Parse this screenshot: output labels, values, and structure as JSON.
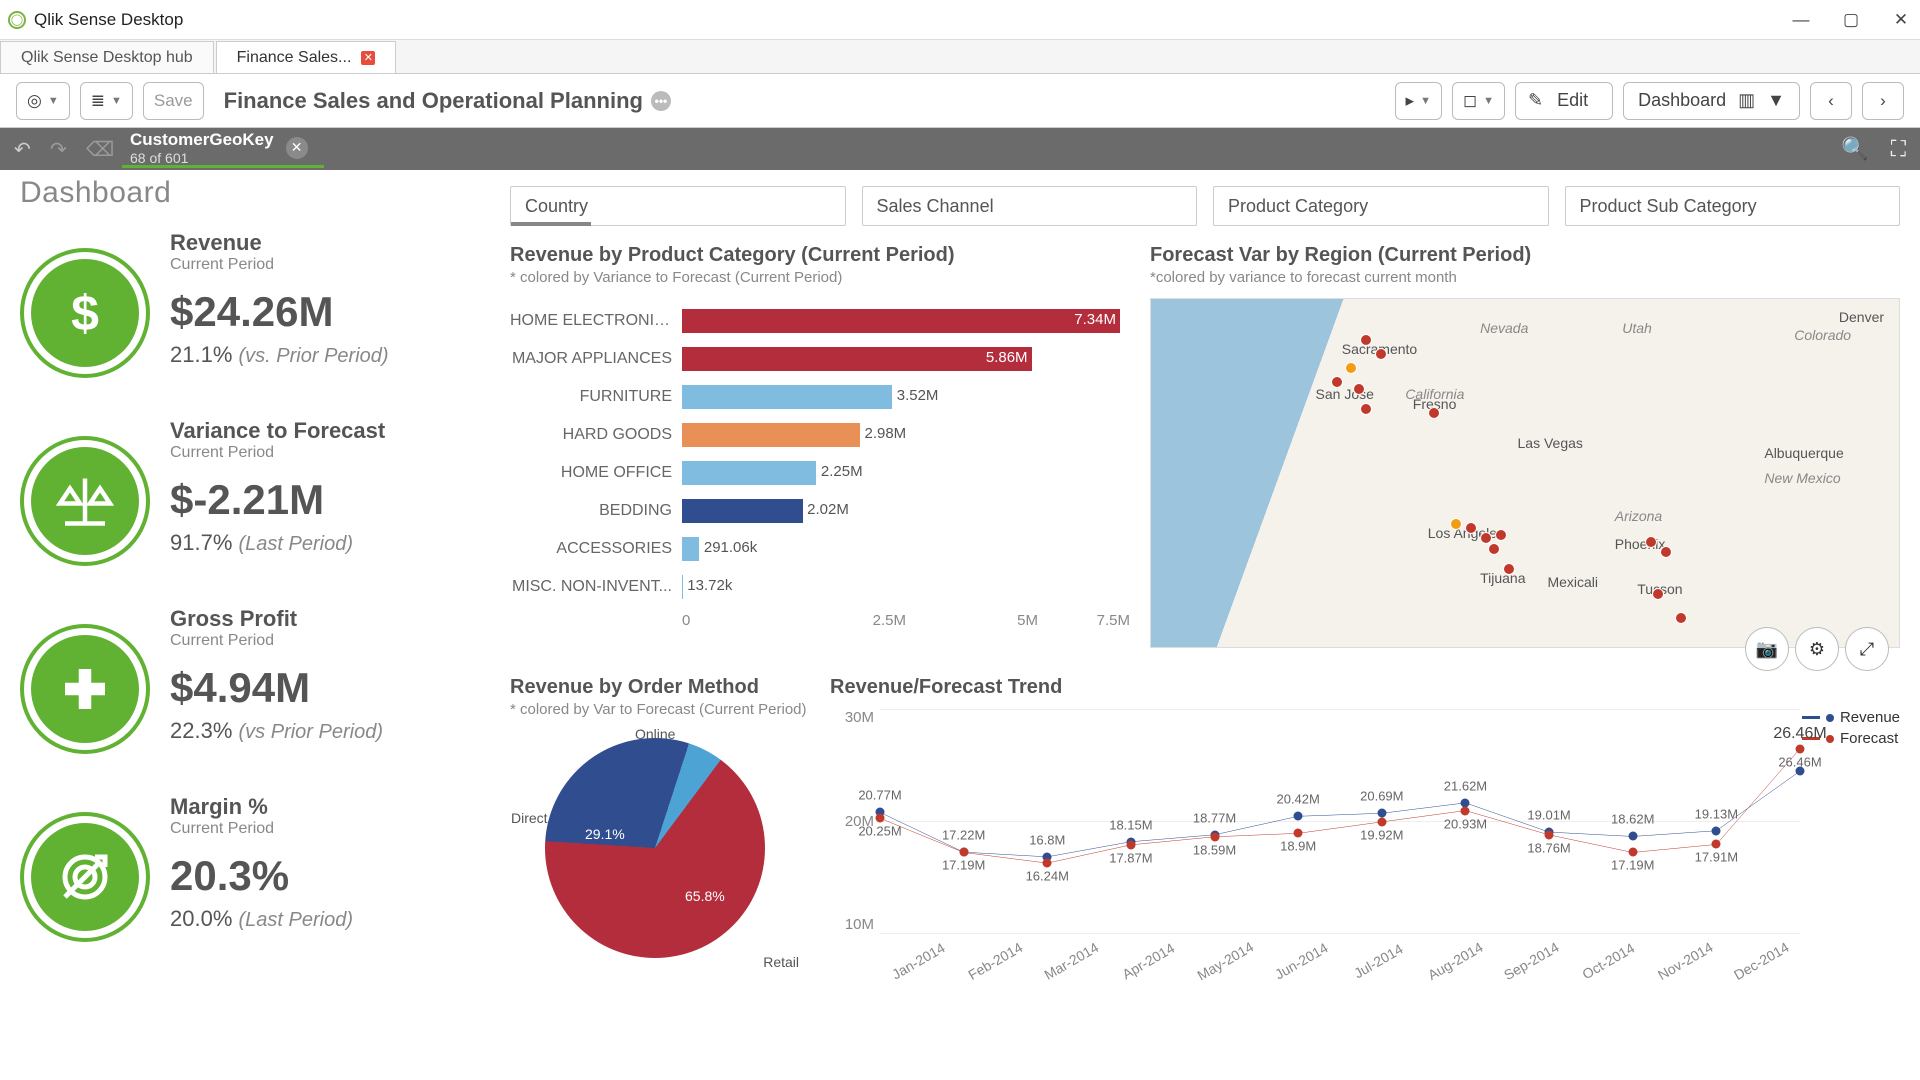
{
  "window_title": "Qlik Sense Desktop",
  "tabs": [
    {
      "label": "Qlik Sense Desktop hub",
      "active": false,
      "closable": false
    },
    {
      "label": "Finance Sales...",
      "active": true,
      "closable": true
    }
  ],
  "toolbar": {
    "save": "Save",
    "app_title": "Finance Sales and Operational Planning",
    "edit": "Edit",
    "sheet": "Dashboard"
  },
  "selection": {
    "field": "CustomerGeoKey",
    "count": "68 of 601"
  },
  "page_title": "Dashboard",
  "filters": [
    {
      "label": "Country",
      "partial": true
    },
    {
      "label": "Sales Channel",
      "partial": false
    },
    {
      "label": "Product Category",
      "partial": false
    },
    {
      "label": "Product Sub Category",
      "partial": false
    }
  ],
  "kpis": [
    {
      "title": "Revenue",
      "sub": "Current Period",
      "value": "$24.26M",
      "change_pct": "21.1%",
      "change_note": "(vs. Prior Period)",
      "icon": "dollar"
    },
    {
      "title": "Variance to Forecast",
      "sub": "Current Period",
      "value": "$-2.21M",
      "change_pct": "91.7%",
      "change_note": "(Last Period)",
      "icon": "scale"
    },
    {
      "title": "Gross Profit",
      "sub": "Current Period",
      "value": "$4.94M",
      "change_pct": "22.3%",
      "change_note": "(vs Prior Period)",
      "icon": "plus"
    },
    {
      "title": "Margin %",
      "sub": "Current Period",
      "value": "20.3%",
      "change_pct": "20.0%",
      "change_note": "(Last Period)",
      "icon": "target"
    }
  ],
  "barChart": {
    "title": "Revenue by Product Category (Current Period)",
    "sub": "* colored by Variance to Forecast (Current Period)",
    "axis": [
      "0",
      "2.5M",
      "5M",
      "7.5M"
    ]
  },
  "map": {
    "title": "Forecast Var by Region (Current Period)",
    "sub": "*colored by variance to forecast current month",
    "labels": {
      "nevada": "Nevada",
      "utah": "Utah",
      "colorado": "Colorado",
      "california": "California",
      "arizona": "Arizona",
      "newmexico": "New Mexico"
    },
    "cities": {
      "denver": "Denver",
      "sacramento": "Sacramento",
      "sanjose": "San Jose",
      "fresno": "Fresno",
      "lasvegas": "Las Vegas",
      "albuquerque": "Albuquerque",
      "losangeles": "Los Angeles",
      "phoenix": "Phoenix",
      "tucson": "Tucson",
      "tijuana": "Tijuana",
      "mexicali": "Mexicali"
    }
  },
  "pie": {
    "title": "Revenue by Order Method",
    "sub": "* colored by Var to Forecast (Current Period)",
    "labels": {
      "online": "Online",
      "direct": "Direct",
      "retail": "Retail",
      "directpct": "29.1%",
      "retailpct": "65.8%"
    }
  },
  "trend": {
    "title": "Revenue/Forecast Trend",
    "yaxis": [
      "30M",
      "20M",
      "10M"
    ],
    "legend": {
      "rev": "Revenue",
      "fc": "Forecast"
    },
    "last_label": "26.46M"
  },
  "chart_data": [
    {
      "type": "bar",
      "title": "Revenue by Product Category (Current Period)",
      "xlabel": "",
      "ylabel": "",
      "ylim": [
        0,
        7500000
      ],
      "categories": [
        "HOME ELECTRONICS",
        "MAJOR APPLIANCES",
        "FURNITURE",
        "HARD GOODS",
        "HOME OFFICE",
        "BEDDING",
        "ACCESSORIES",
        "MISC. NON-INVENT..."
      ],
      "values": [
        7340000,
        5860000,
        3520000,
        2980000,
        2250000,
        2020000,
        291060,
        13720
      ],
      "value_labels": [
        "7.34M",
        "5.86M",
        "3.52M",
        "2.98M",
        "2.25M",
        "2.02M",
        "291.06k",
        "13.72k"
      ],
      "colors": [
        "#b32d3c",
        "#b32d3c",
        "#7fbce0",
        "#e89055",
        "#7fbce0",
        "#2f4d8f",
        "#7fbce0",
        "#7fbce0"
      ]
    },
    {
      "type": "pie",
      "title": "Revenue by Order Method",
      "categories": [
        "Retail",
        "Direct",
        "Online"
      ],
      "values": [
        65.8,
        29.1,
        5.1
      ],
      "colors": [
        "#b32d3c",
        "#2f4d8f",
        "#4da3d4"
      ]
    },
    {
      "type": "line",
      "title": "Revenue/Forecast Trend",
      "ylabel": "",
      "ylim": [
        10000000,
        30000000
      ],
      "x": [
        "Jan-2014",
        "Feb-2014",
        "Mar-2014",
        "Apr-2014",
        "May-2014",
        "Jun-2014",
        "Jul-2014",
        "Aug-2014",
        "Sep-2014",
        "Oct-2014",
        "Nov-2014",
        "Dec-2014"
      ],
      "series": [
        {
          "name": "Revenue",
          "color": "#2f4d8f",
          "values": [
            20770000,
            17220000,
            16800000,
            18150000,
            18770000,
            20420000,
            20690000,
            21620000,
            19010000,
            18620000,
            19130000,
            24460000
          ],
          "labels": [
            "20.77M",
            "17.22M",
            "16.8M",
            "18.15M",
            "18.77M",
            "20.42M",
            "20.69M",
            "21.62M",
            "19.01M",
            "18.62M",
            "19.13M",
            ""
          ]
        },
        {
          "name": "Forecast",
          "color": "#c0392b",
          "values": [
            20250000,
            17190000,
            16240000,
            17870000,
            18590000,
            18900000,
            19920000,
            20930000,
            18760000,
            17190000,
            17910000,
            26460000
          ],
          "labels": [
            "20.25M",
            "17.19M",
            "16.24M",
            "17.87M",
            "18.59M",
            "18.9M",
            "19.92M",
            "20.93M",
            "18.76M",
            "17.19M",
            "17.91M",
            "26.46M"
          ]
        }
      ]
    }
  ]
}
